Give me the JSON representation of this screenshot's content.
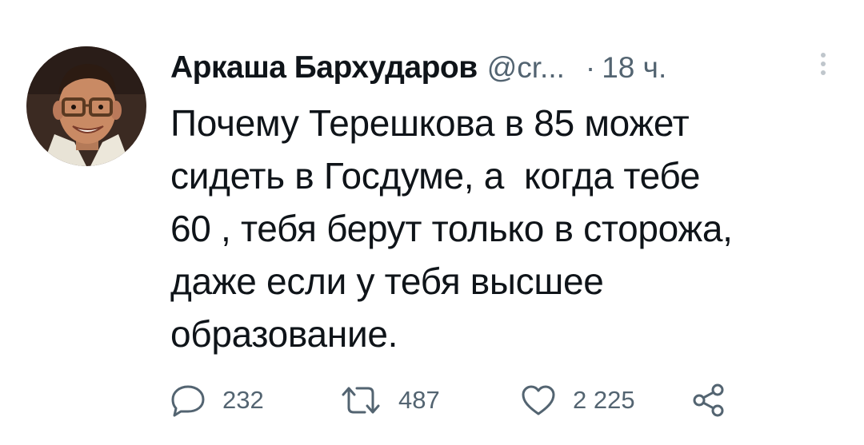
{
  "tweet": {
    "author_name": "Аркаша Бархударов",
    "handle": "@cr...",
    "separator": "·",
    "time": "18 ч.",
    "text": "Почему Терешкова в 85 может\nсидеть в Госдуме, а  когда тебе\n60 , тебя берут только в сторожа,\nдаже если у тебя высшее\nобразование.",
    "actions": {
      "reply_count": "232",
      "retweet_count": "487",
      "like_count": "2 225"
    },
    "icons": {
      "reply": "reply-icon",
      "retweet": "retweet-icon",
      "like": "like-icon",
      "share": "share-icon",
      "more": "more-icon"
    },
    "colors": {
      "text": "#0f1419",
      "secondary": "#536471",
      "background": "#ffffff"
    }
  }
}
